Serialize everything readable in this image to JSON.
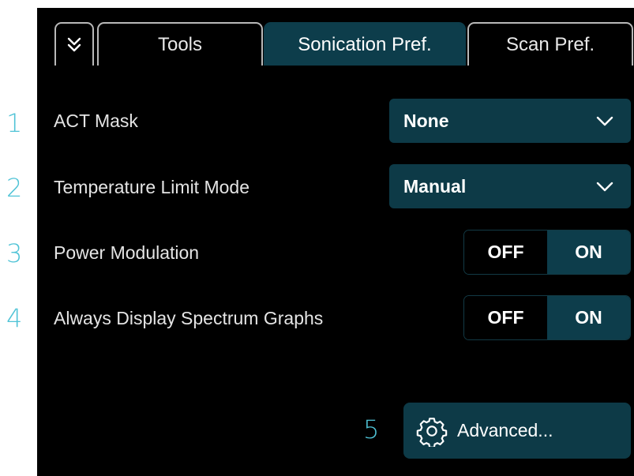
{
  "callouts": [
    "1",
    "2",
    "3",
    "4",
    "5"
  ],
  "tabs": {
    "tools": "Tools",
    "sonication": "Sonication Pref.",
    "scan": "Scan Pref."
  },
  "settings": {
    "act_mask": {
      "label": "ACT Mask",
      "value": "None"
    },
    "temp_limit_mode": {
      "label": "Temperature Limit Mode",
      "value": "Manual"
    },
    "power_modulation": {
      "label": "Power Modulation",
      "off": "OFF",
      "on": "ON",
      "selected": "ON"
    },
    "spectrum_graphs": {
      "label": "Always Display Spectrum Graphs",
      "off": "OFF",
      "on": "ON",
      "selected": "ON"
    }
  },
  "advanced_button": {
    "label": "Advanced..."
  },
  "colors": {
    "accent": "#0d3d4b",
    "callout": "#4fc3d6",
    "background": "#000000"
  },
  "icons": [
    "double-chevron-down-icon",
    "chevron-down-icon",
    "gear-icon"
  ]
}
